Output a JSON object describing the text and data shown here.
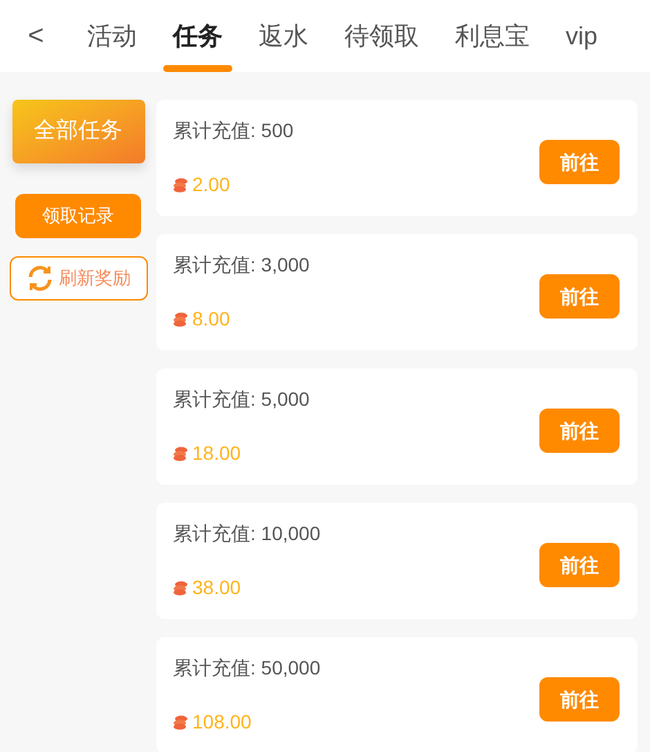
{
  "back": "<",
  "tabs": [
    {
      "label": "活动",
      "selected": false
    },
    {
      "label": "任务",
      "selected": true
    },
    {
      "label": "返水",
      "selected": false
    },
    {
      "label": "待领取",
      "selected": false
    },
    {
      "label": "利息宝",
      "selected": false
    },
    {
      "label": "vip",
      "selected": false
    }
  ],
  "sidebar": {
    "items": [
      {
        "label": "全部任务",
        "selected": true
      }
    ],
    "history_button": "领取记录",
    "refresh_button": "刷新奖励"
  },
  "tasks": [
    {
      "title": "累计充值: 500",
      "reward": "2.00",
      "button": "前往"
    },
    {
      "title": "累计充值: 3,000",
      "reward": "8.00",
      "button": "前往"
    },
    {
      "title": "累计充值: 5,000",
      "reward": "18.00",
      "button": "前往"
    },
    {
      "title": "累计充值: 10,000",
      "reward": "38.00",
      "button": "前往"
    },
    {
      "title": "累计充值: 50,000",
      "reward": "108.00",
      "button": "前往"
    }
  ]
}
